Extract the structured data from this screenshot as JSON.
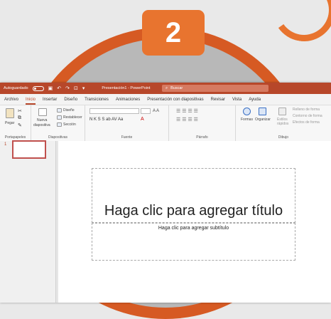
{
  "step": "2",
  "titlebar": {
    "autosave": "Autoguardado",
    "document": "Presentación1 - PowerPoint",
    "search_placeholder": "Buscar"
  },
  "tabs": [
    "Archivo",
    "Inicio",
    "Insertar",
    "Diseño",
    "Transiciones",
    "Animaciones",
    "Presentación con diapositivas",
    "Revisar",
    "Vista",
    "Ayuda"
  ],
  "ribbon": {
    "pegar": "Pegar",
    "nueva": "Nueva",
    "diapositiva": "diapositiva",
    "diseno": "Diseño",
    "restablecer": "Restablecer",
    "seccion": "Sección",
    "formas": "Formas",
    "organizar": "Organizar",
    "estilos": "Estilos",
    "rapidos": "rápidos",
    "relleno": "Relleno de forma",
    "contorno": "Contorno de forma",
    "efectos": "Efectos de forma",
    "groups": {
      "portapapeles": "Portapapeles",
      "diapositivas": "Diapositivas",
      "fuente": "Fuente",
      "parrafo": "Párrafo",
      "dibujo": "Dibujo"
    },
    "font_format": "N  K  S  S  ab  AV  Aa",
    "font_sizes": "A  A"
  },
  "slide_panel": {
    "slide_number": "1"
  },
  "slide": {
    "title_placeholder": "Haga clic para agregar título",
    "subtitle_placeholder": "Haga clic para agregar subtítulo"
  },
  "colors": {
    "accent": "#b7472a",
    "badge": "#e8742f"
  }
}
